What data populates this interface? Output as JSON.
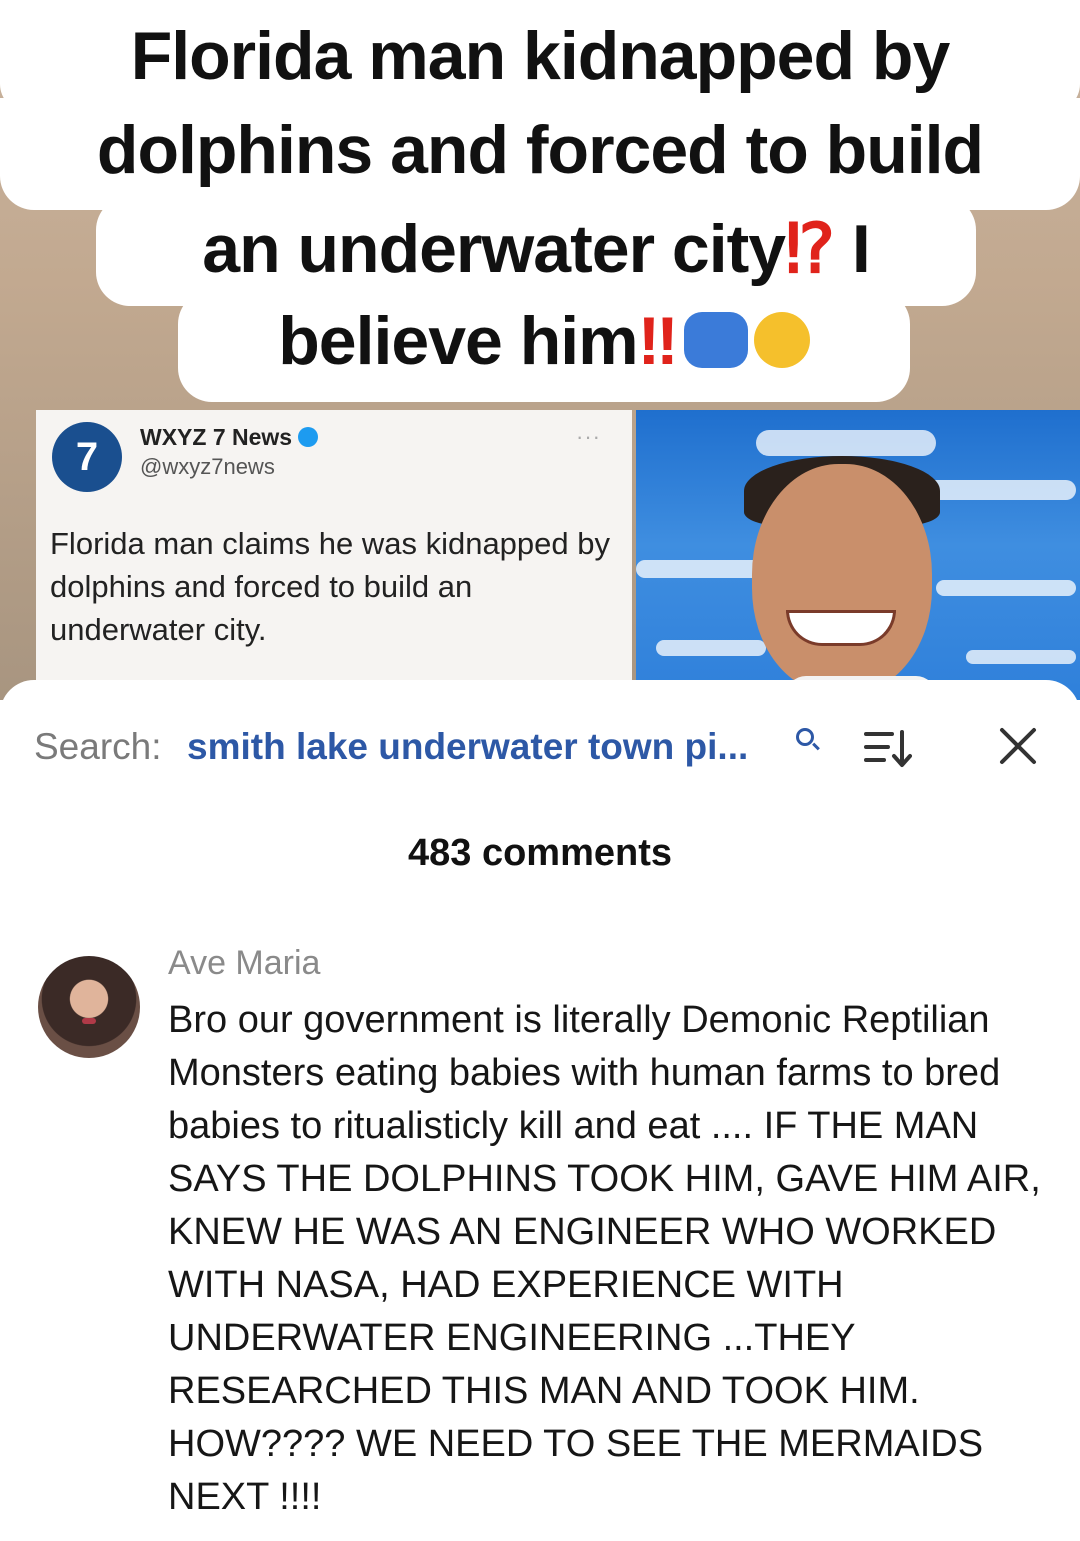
{
  "video": {
    "caption": {
      "line1": "Florida man kidnapped by",
      "line2": "dolphins and forced to build",
      "line3_text": "an underwater city",
      "line3_punct": "⁉",
      "line3_tail": " I",
      "line4_text": "believe him",
      "line4_punct": "‼",
      "emoji_1": "man-shrugging-emoji",
      "emoji_2": "face-with-tears-of-joy-emoji"
    },
    "tweet": {
      "logo_text": "7",
      "name": "WXYZ 7 News",
      "handle": "@wxyz7news",
      "more": "···",
      "text": "Florida man claims he was kidnapped by dolphins and forced to build an underwater city."
    }
  },
  "search": {
    "label": "Search:",
    "query": "smith lake underwater town pi..."
  },
  "comments": {
    "count_text": "483 comments",
    "items": [
      {
        "author": "Ave Maria",
        "text": "Bro our government is literally Demonic Reptilian Monsters eating babies with human farms to bred babies to ritualisticly kill and eat .... IF THE MAN SAYS THE DOLPHINS TOOK HIM, GAVE HIM AIR, KNEW HE WAS AN ENGINEER WHO WORKED WITH NASA, HAD EXPERIENCE WITH UNDERWATER ENGINEERING ...THEY RESEARCHED THIS MAN AND TOOK HIM. HOW???? WE NEED TO SEE THE MERMAIDS NEXT !!!!"
      }
    ]
  },
  "colors": {
    "accent_blue": "#2d58a6",
    "caption_red": "#e0231b",
    "muted_gray": "#7a7a7a"
  }
}
